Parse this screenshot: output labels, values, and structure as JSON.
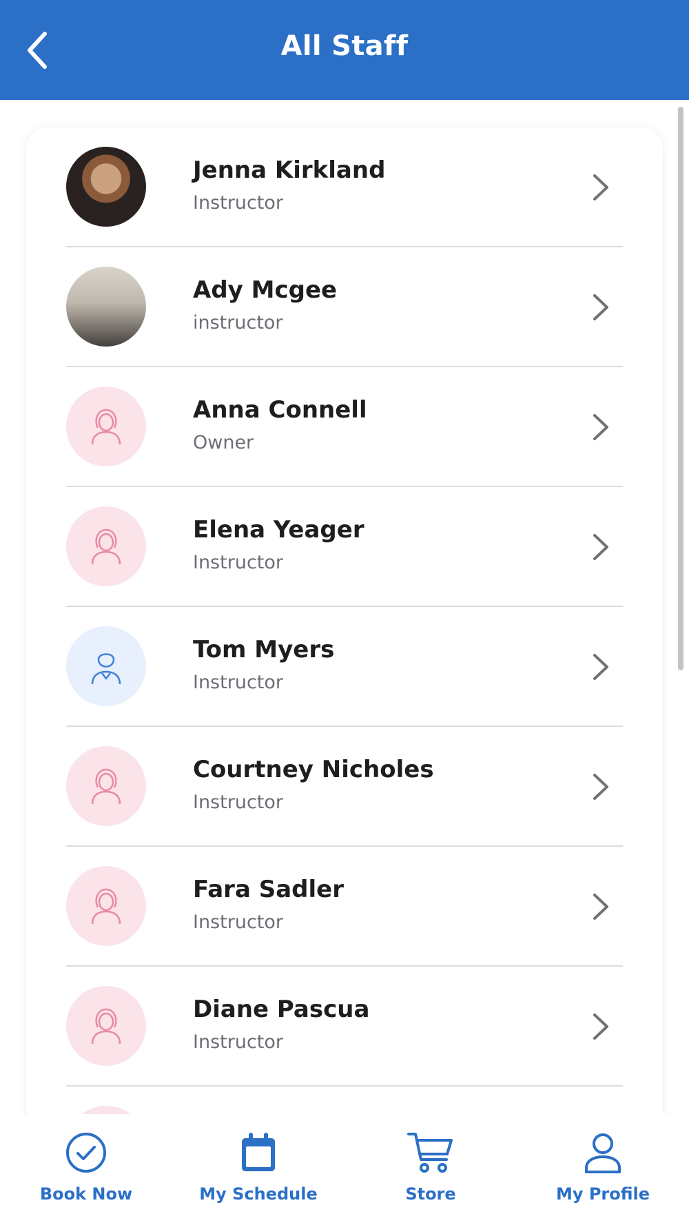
{
  "header": {
    "title": "All Staff",
    "back_icon": "chevron-left-icon"
  },
  "staff": [
    {
      "name": "Jenna Kirkland",
      "role": "Instructor",
      "avatar": "photo"
    },
    {
      "name": "Ady Mcgee",
      "role": "instructor",
      "avatar": "photo"
    },
    {
      "name": "Anna Connell",
      "role": "Owner",
      "avatar": "female-placeholder"
    },
    {
      "name": "Elena Yeager",
      "role": "Instructor",
      "avatar": "female-placeholder"
    },
    {
      "name": "Tom Myers",
      "role": "Instructor",
      "avatar": "male-placeholder"
    },
    {
      "name": "Courtney Nicholes",
      "role": "Instructor",
      "avatar": "female-placeholder"
    },
    {
      "name": "Fara Sadler",
      "role": "Instructor",
      "avatar": "female-placeholder"
    },
    {
      "name": "Diane Pascua",
      "role": "Instructor",
      "avatar": "female-placeholder"
    }
  ],
  "bottom_nav": [
    {
      "label": "Book Now",
      "icon": "check-circle-icon"
    },
    {
      "label": "My Schedule",
      "icon": "calendar-icon"
    },
    {
      "label": "Store",
      "icon": "cart-icon"
    },
    {
      "label": "My Profile",
      "icon": "user-icon"
    }
  ],
  "colors": {
    "primary": "#2b6fc7",
    "female_avatar_bg": "#fbe3ea",
    "female_avatar_icon": "#e88aa3",
    "male_avatar_bg": "#e8effd",
    "male_avatar_icon": "#3f82d8"
  }
}
